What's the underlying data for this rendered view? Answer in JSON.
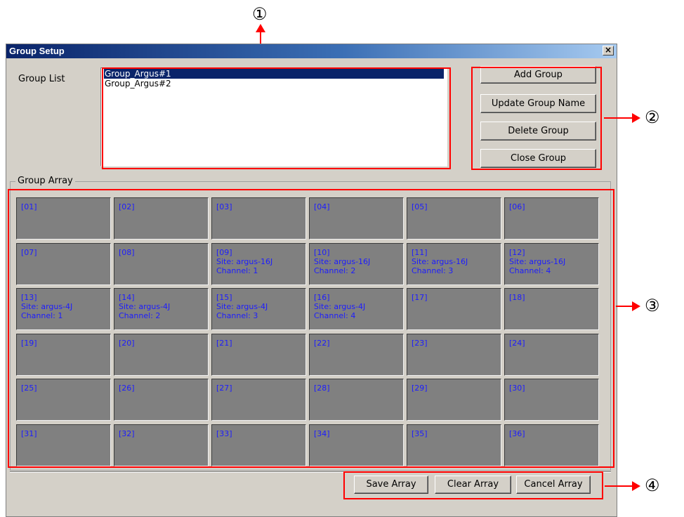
{
  "window": {
    "title": "Group Setup",
    "close_glyph": "×"
  },
  "group_list": {
    "label": "Group List",
    "items": [
      "Group_Argus#1",
      "Group_Argus#2"
    ]
  },
  "buttons": {
    "add_group": "Add Group",
    "update_group_name": "Update Group Name",
    "delete_group": "Delete Group",
    "close_group": "Close Group"
  },
  "group_array": {
    "label": "Group Array",
    "cells": [
      [
        "[01]"
      ],
      [
        "[02]"
      ],
      [
        "[03]"
      ],
      [
        "[04]"
      ],
      [
        "[05]"
      ],
      [
        "[06]"
      ],
      [
        "[07]"
      ],
      [
        "[08]"
      ],
      [
        "[09]",
        "Site: argus-16J",
        "Channel: 1"
      ],
      [
        "[10]",
        "Site: argus-16J",
        "Channel: 2"
      ],
      [
        "[11]",
        "Site: argus-16J",
        "Channel: 3"
      ],
      [
        "[12]",
        "Site: argus-16J",
        "Channel: 4"
      ],
      [
        "[13]",
        "Site: argus-4J",
        "Channel: 1"
      ],
      [
        "[14]",
        "Site: argus-4J",
        "Channel: 2"
      ],
      [
        "[15]",
        "Site: argus-4J",
        "Channel: 3"
      ],
      [
        "[16]",
        "Site: argus-4J",
        "Channel: 4"
      ],
      [
        "[17]"
      ],
      [
        "[18]"
      ],
      [
        "[19]"
      ],
      [
        "[20]"
      ],
      [
        "[21]"
      ],
      [
        "[22]"
      ],
      [
        "[23]"
      ],
      [
        "[24]"
      ],
      [
        "[25]"
      ],
      [
        "[26]"
      ],
      [
        "[27]"
      ],
      [
        "[28]"
      ],
      [
        "[29]"
      ],
      [
        "[30]"
      ],
      [
        "[31]"
      ],
      [
        "[32]"
      ],
      [
        "[33]"
      ],
      [
        "[34]"
      ],
      [
        "[35]"
      ],
      [
        "[36]"
      ]
    ]
  },
  "array_buttons": {
    "save": "Save Array",
    "clear": "Clear Array",
    "cancel": "Cancel Array"
  },
  "annotations": {
    "marker_1": "①",
    "marker_2": "②",
    "marker_3": "③",
    "marker_4": "④",
    "highlight_color": "#ff0000"
  }
}
